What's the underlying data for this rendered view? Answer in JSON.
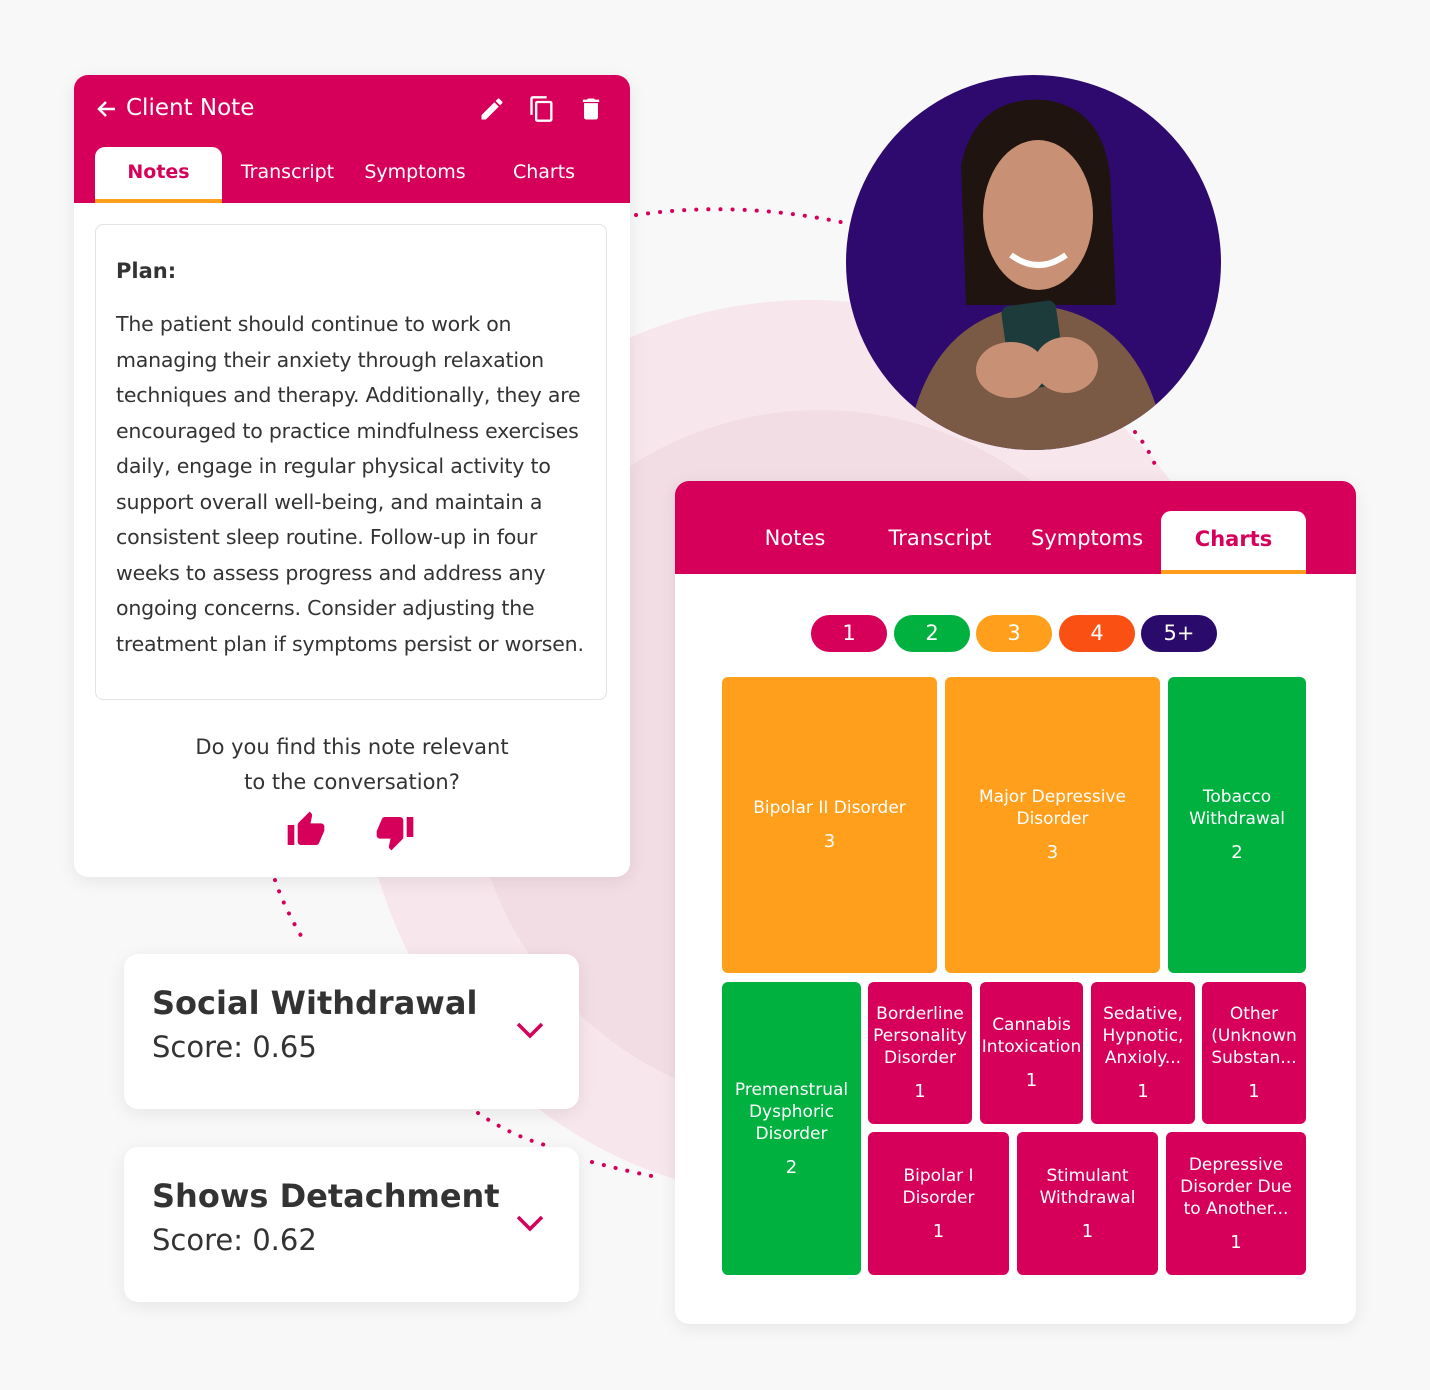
{
  "colors": {
    "brand": "#d6005a",
    "orange": "#ff9f1c",
    "green": "#00b140",
    "red_orange": "#fa5014",
    "navy": "#2a0a6b"
  },
  "note_card": {
    "title": "Client Note",
    "icons": [
      "arrow-left-icon",
      "pencil-icon",
      "copy-icon",
      "trash-icon"
    ],
    "tabs": [
      {
        "label": "Notes",
        "active": true
      },
      {
        "label": "Transcript"
      },
      {
        "label": "Symptoms"
      },
      {
        "label": "Charts"
      }
    ],
    "heading": "Plan:",
    "body": "The patient should continue to work on managing their anxiety through relaxation techniques and therapy. Additionally, they are encouraged to practice mindfulness exercises daily, engage in regular physical activity to support overall well-being, and maintain a consistent sleep routine. Follow-up in four weeks to assess progress and address any ongoing concerns. Consider adjusting the treatment plan if symptoms persist or worsen.",
    "question_line1": "Do you find this note relevant",
    "question_line2": "to the conversation?"
  },
  "symptoms": [
    {
      "title": "Social Withdrawal",
      "score": "Score: 0.65"
    },
    {
      "title": "Shows Detachment",
      "score": "Score: 0.62"
    }
  ],
  "charts_card": {
    "tabs": [
      {
        "label": "Notes"
      },
      {
        "label": "Transcript"
      },
      {
        "label": "Symptoms"
      },
      {
        "label": "Charts",
        "active": true
      }
    ],
    "legend": [
      "1",
      "2",
      "3",
      "4",
      "5+"
    ],
    "tiles": [
      {
        "label": "Bipolar II Disorder",
        "value": "3"
      },
      {
        "label": "Major Depressive Disorder",
        "value": "3"
      },
      {
        "label": "Tobacco Withdrawal",
        "value": "2"
      },
      {
        "label": "Premenstrual Dysphoric Disorder",
        "value": "2"
      },
      {
        "label": "Borderline Personality Disorder",
        "value": "1"
      },
      {
        "label": "Cannabis Intoxication",
        "value": "1"
      },
      {
        "label": "Sedative, Hypnotic, Anxioly...",
        "value": "1"
      },
      {
        "label": "Other (Unknown Substan...",
        "value": "1"
      },
      {
        "label": "Bipolar I Disorder",
        "value": "1"
      },
      {
        "label": "Stimulant Withdrawal",
        "value": "1"
      },
      {
        "label": "Depressive Disorder Due to Another...",
        "value": "1"
      }
    ]
  }
}
